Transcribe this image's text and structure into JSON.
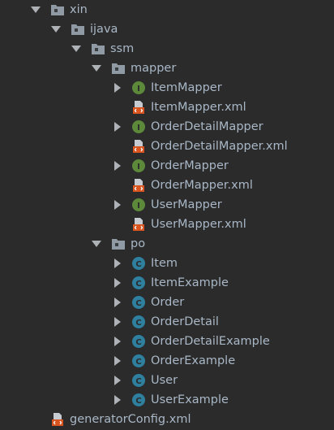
{
  "colors": {
    "background": "#2b2b2b",
    "text": "#a9b7c6",
    "arrow": "#aeb2b6",
    "folder": "#8f9aa5",
    "interface_badge": "#5c8a3a",
    "class_badge": "#2f7f9e",
    "xml_tag": "#d9541e"
  },
  "tree": {
    "xin": "xin",
    "ijava": "ijava",
    "ssm": "ssm",
    "mapper": {
      "label": "mapper",
      "item_mapper": "ItemMapper",
      "item_mapper_xml": "ItemMapper.xml",
      "order_detail_mapper": "OrderDetailMapper",
      "order_detail_mapper_xml": "OrderDetailMapper.xml",
      "order_mapper": "OrderMapper",
      "order_mapper_xml": "OrderMapper.xml",
      "user_mapper": "UserMapper",
      "user_mapper_xml": "UserMapper.xml"
    },
    "po": {
      "label": "po",
      "item": "Item",
      "item_example": "ItemExample",
      "order": "Order",
      "order_detail": "OrderDetail",
      "order_detail_example": "OrderDetailExample",
      "order_example": "OrderExample",
      "user": "User",
      "user_example": "UserExample"
    },
    "generator_config": "generatorConfig.xml"
  },
  "badges": {
    "interface_letter": "I",
    "class_letter": "C"
  },
  "icons": {
    "expanded": "chevron-down-icon",
    "collapsed": "chevron-right-icon",
    "folder": "folder-icon",
    "interface": "interface-icon",
    "class": "class-icon",
    "xml": "xml-file-icon"
  }
}
